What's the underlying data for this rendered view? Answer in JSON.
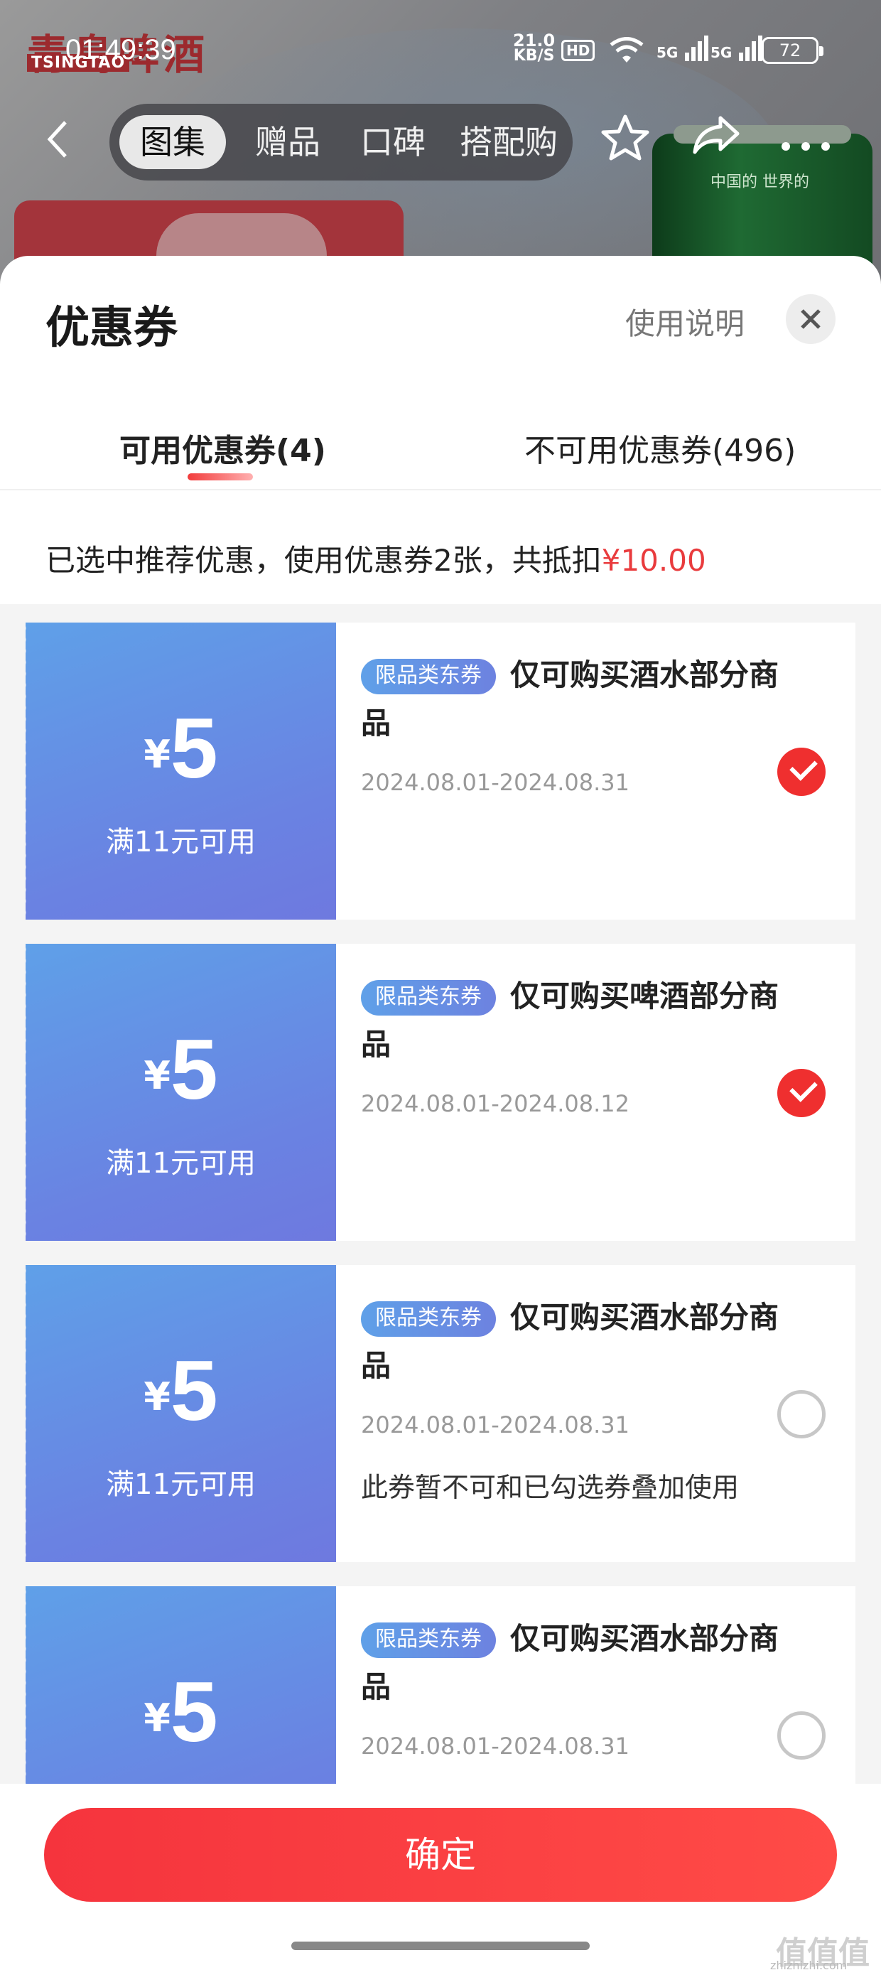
{
  "status_bar": {
    "time": "01:49:39",
    "net_speed": "21.0",
    "net_unit": "KB/S",
    "hd": "HD",
    "sig1": "5G",
    "sig2": "5G",
    "battery": "72"
  },
  "background": {
    "brand_logo": "青島啤酒",
    "brand_en": "TSINGTAO",
    "can_text": "中国的 世界的"
  },
  "nav": {
    "tabs": [
      "图集",
      "赠品",
      "口碑",
      "搭配购"
    ]
  },
  "sheet": {
    "title": "优惠券",
    "usage_link": "使用说明",
    "tab_available": "可用优惠券(4)",
    "tab_unavailable": "不可用优惠券(496)",
    "summary_text": "已选中推荐优惠，使用优惠券2张，共抵扣",
    "summary_amount": "¥10.00",
    "confirm_button": "确定"
  },
  "coupons": [
    {
      "currency": "¥",
      "amount": "5",
      "condition": "满11元可用",
      "tag": "限品类东券",
      "title": "仅可购买酒水部分商品",
      "date": "2024.08.01-2024.08.31",
      "note": "",
      "selected": true
    },
    {
      "currency": "¥",
      "amount": "5",
      "condition": "满11元可用",
      "tag": "限品类东券",
      "title": "仅可购买啤酒部分商品",
      "date": "2024.08.01-2024.08.12",
      "note": "",
      "selected": true
    },
    {
      "currency": "¥",
      "amount": "5",
      "condition": "满11元可用",
      "tag": "限品类东券",
      "title": "仅可购买酒水部分商品",
      "date": "2024.08.01-2024.08.31",
      "note": "此券暂不可和已勾选券叠加使用",
      "selected": false
    },
    {
      "currency": "¥",
      "amount": "5",
      "condition": "",
      "tag": "限品类东券",
      "title": "仅可购买酒水部分商品",
      "date": "2024.08.01-2024.08.31",
      "note": "",
      "selected": false
    }
  ],
  "watermark": {
    "mark": "值值值",
    "domain": "zhizhizhi.com"
  },
  "colors": {
    "accent_red": "#e93b3d",
    "coupon_blue": "#6a82e2"
  }
}
